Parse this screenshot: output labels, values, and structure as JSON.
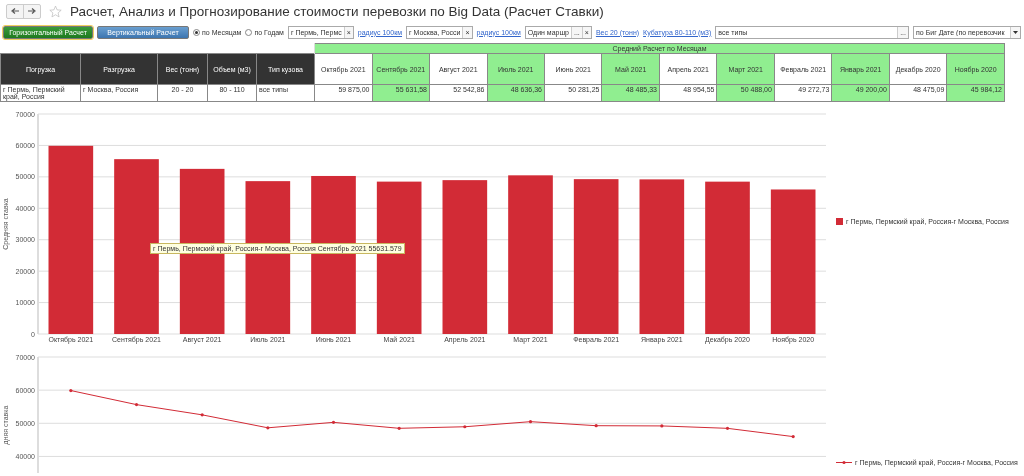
{
  "window": {
    "title": "Расчет, Анализ и Прогнозирование стоимости перевозки по Big Data (Расчет Ставки)"
  },
  "toolbar": {
    "buttons": [
      {
        "label": "Горизонтальный Расчет",
        "kind": "green",
        "focused": true
      },
      {
        "label": "Вертикальный Расчет",
        "kind": "blue",
        "focused": false
      }
    ],
    "radios": [
      {
        "label": "по Месяцам",
        "selected": true
      },
      {
        "label": "по Годам",
        "selected": false
      }
    ],
    "filters": [
      {
        "kind": "field",
        "value": "г Пермь,  Пермс",
        "clear": "×"
      },
      {
        "kind": "link",
        "label": "радиус 100км"
      },
      {
        "kind": "field",
        "value": "г Москва, Росси",
        "clear": "×"
      },
      {
        "kind": "link",
        "label": "радиус 100км"
      },
      {
        "kind": "field",
        "value": "Один маршр",
        "choose": "...",
        "clear": "×"
      },
      {
        "kind": "link",
        "label": "Вес 20 (тонн)"
      },
      {
        "kind": "link",
        "label": "Кубатура 80-110 (м3)"
      },
      {
        "kind": "wide",
        "value": "все типы",
        "choose": "..."
      },
      {
        "kind": "select",
        "value": "по Биг Дате (по перевозчик"
      }
    ]
  },
  "table": {
    "group_header": "Средний Расчет по Месяцам",
    "columns": [
      "Погрузка",
      "Разгрузка",
      "Вес (тонн)",
      "Объем (м3)",
      "Тип кузова"
    ],
    "months": [
      {
        "label": "Октябрь 2021",
        "highlighted": false
      },
      {
        "label": "Сентябрь 2021",
        "highlighted": true
      },
      {
        "label": "Август 2021",
        "highlighted": false
      },
      {
        "label": "Июль 2021",
        "highlighted": true
      },
      {
        "label": "Июнь 2021",
        "highlighted": false
      },
      {
        "label": "Май 2021",
        "highlighted": true
      },
      {
        "label": "Апрель 2021",
        "highlighted": false
      },
      {
        "label": "Март 2021",
        "highlighted": true
      },
      {
        "label": "Февраль 2021",
        "highlighted": false
      },
      {
        "label": "Январь 2021",
        "highlighted": true
      },
      {
        "label": "Декабрь 2020",
        "highlighted": false
      },
      {
        "label": "Ноябрь 2020",
        "highlighted": true
      }
    ],
    "rows": [
      {
        "cells": [
          "г Пермь,  Пермский край, Россия",
          "г Москва, Россия",
          "20 - 20",
          "80 - 110",
          "все типы"
        ],
        "values": [
          "59 875,00",
          "55 631,58",
          "52 542,86",
          "48 636,36",
          "50 281,25",
          "48 485,33",
          "48 954,55",
          "50 488,00",
          "49 272,73",
          "49 200,00",
          "48 475,09",
          "45 984,12"
        ]
      }
    ]
  },
  "bar_chart": {
    "tooltip": "г Пермь,  Пермский край, Россия-г  Москва, Россия Сентябрь 2021 55631.579",
    "chart_data": {
      "type": "bar",
      "ylabel": "Средняя ставка",
      "grid": true,
      "categories": [
        "Октябрь 2021",
        "Сентябрь 2021",
        "Август 2021",
        "Июль 2021",
        "Июнь 2021",
        "Май 2021",
        "Апрель 2021",
        "Март 2021",
        "Февраль 2021",
        "Январь 2021",
        "Декабрь 2020",
        "Ноябрь 2020"
      ],
      "series": [
        {
          "name": "г Пермь,  Пермский край, Россия-г Москва, Россия",
          "color": "#d22b36",
          "values": [
            59875,
            55631.58,
            52542.86,
            48636.36,
            50281.25,
            48485.33,
            48954.55,
            50488,
            49272.73,
            49200,
            48475.09,
            45984.12
          ]
        }
      ],
      "ylim": [
        0,
        70000
      ],
      "yticks": [
        0,
        10000,
        20000,
        30000,
        40000,
        50000,
        60000,
        70000
      ]
    }
  },
  "line_chart": {
    "chart_data": {
      "type": "line",
      "ylabel": "дняя ставка",
      "grid": true,
      "series": [
        {
          "name": "г Пермь,  Пермский край, Россия-г Москва, Россия",
          "color": "#d22b36",
          "values": [
            59875,
            55631.58,
            52542.86,
            48636.36,
            50281.25,
            48485.33,
            48954.55,
            50488,
            49272.73,
            49200,
            48475.09,
            45984.12
          ]
        }
      ],
      "ylim": [
        35000,
        70000
      ],
      "yticks": [
        40000,
        50000,
        60000,
        70000
      ]
    }
  }
}
